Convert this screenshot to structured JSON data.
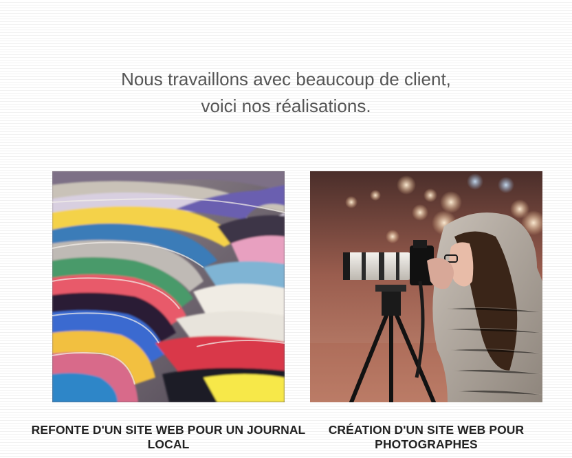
{
  "intro": {
    "line1": "Nous travaillons avec beaucoup de client,",
    "line2": "voici nos réalisations."
  },
  "projects": [
    {
      "title": "REFONTE D'UN SITE WEB POUR UN JOURNAL LOCAL",
      "image": "magazines-stack-photo"
    },
    {
      "title": "CRÉATION D'UN SITE WEB POUR PHOTOGRAPHES",
      "image": "photographer-with-camera-photo"
    }
  ]
}
